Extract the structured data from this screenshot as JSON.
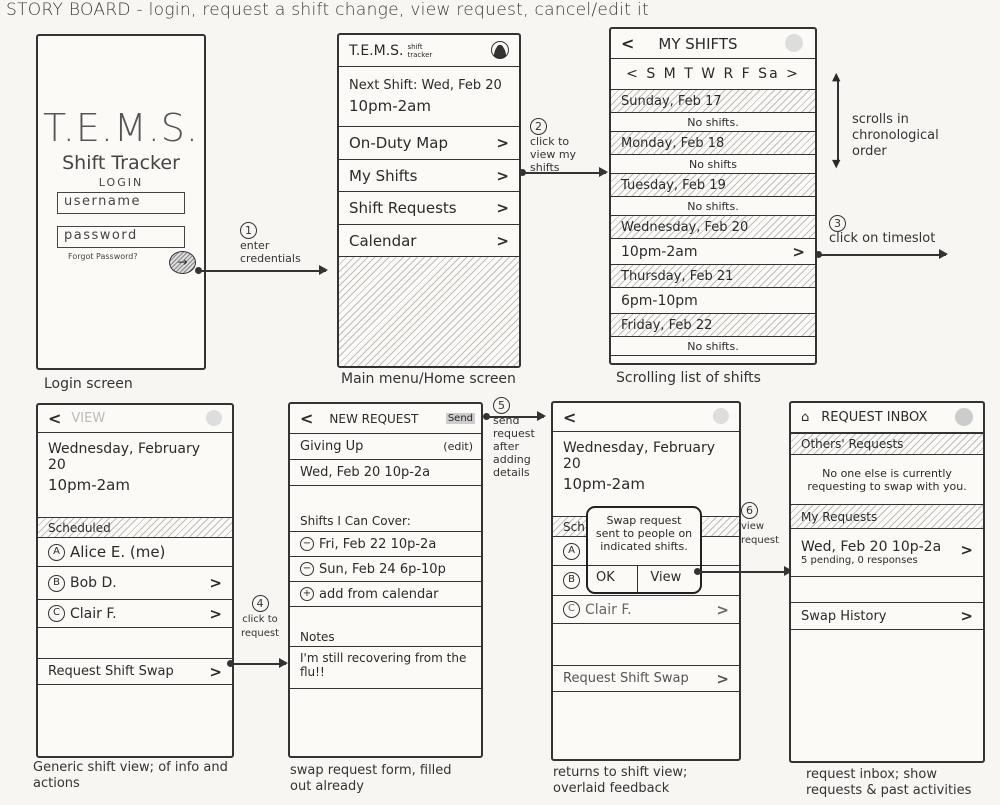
{
  "title": "STORY BOARD - login, request a shift change, view request, cancel/edit it",
  "screens": {
    "login": {
      "logo": "T.E.M.S.",
      "subtitle": "Shift Tracker",
      "heading": "LOGIN",
      "username_placeholder": "username",
      "password_placeholder": "password",
      "forgot_link": "Forgot Password?",
      "submit_icon": "arrow-right-icon",
      "caption": "Login screen"
    },
    "home": {
      "app_name": "T.E.M.S.",
      "app_sub": "shift tracker",
      "next_shift_label": "Next Shift: Wed, Feb 20",
      "next_shift_time": "10pm-2am",
      "menu": [
        {
          "label": "On-Duty Map"
        },
        {
          "label": "My Shifts"
        },
        {
          "label": "Shift Requests"
        },
        {
          "label": "Calendar"
        }
      ],
      "caption": "Main menu/Home screen"
    },
    "my_shifts": {
      "header": "MY SHIFTS",
      "week_days": "< S M T W R F Sa >",
      "days": [
        {
          "day": "Sunday, Feb 17",
          "shift": "No shifts."
        },
        {
          "day": "Monday, Feb 18",
          "shift": "No shifts"
        },
        {
          "day": "Tuesday, Feb 19",
          "shift": "No shifts."
        },
        {
          "day": "Wednesday, Feb 20",
          "shift": "10pm-2am"
        },
        {
          "day": "Thursday, Feb 21",
          "shift": "6pm-10pm"
        },
        {
          "day": "Friday, Feb 22",
          "shift": "No shifts."
        }
      ],
      "caption": "Scrolling list of shifts"
    },
    "shift_view": {
      "header": "VIEW",
      "date": "Wednesday, February 20",
      "time": "10pm-2am",
      "section": "Scheduled",
      "people": [
        {
          "name": "Alice E. (me)",
          "icon": "A"
        },
        {
          "name": "Bob D.",
          "icon": "B"
        },
        {
          "name": "Clair F.",
          "icon": "C"
        }
      ],
      "action": "Request Shift Swap",
      "caption": "Generic shift view; of info and actions"
    },
    "new_request": {
      "header": "NEW REQUEST",
      "send": "Send",
      "giving_up_label": "Giving Up",
      "edit": "(edit)",
      "giving_up_value": "Wed, Feb 20 10p-2a",
      "cover_label": "Shifts I Can Cover:",
      "cover_items": [
        {
          "label": "Fri, Feb 22 10p-2a"
        },
        {
          "label": "Sun, Feb 24 6p-10p"
        }
      ],
      "add_label": "add from calendar",
      "notes_label": "Notes",
      "notes_value": "I'm still recovering from the flu!!",
      "caption": "swap request form, filled out already"
    },
    "feedback": {
      "date": "Wednesday, February 20",
      "time": "10pm-2am",
      "section": "Sch",
      "dialog_text": "Swap request sent to people on indicated shifts.",
      "ok": "OK",
      "view": "View",
      "people": [
        {
          "name": "Clair F."
        }
      ],
      "action": "Request Shift Swap",
      "caption": "returns to shift view; overlaid feedback"
    },
    "inbox": {
      "header": "REQUEST INBOX",
      "others_label": "Others' Requests",
      "others_empty": "No one else is currently requesting to swap with you.",
      "mine_label": "My Requests",
      "request_title": "Wed, Feb 20 10p-2a",
      "request_status": "5 pending, 0 responses",
      "history": "Swap History",
      "caption": "request inbox; show requests & past activities"
    }
  },
  "annotations": [
    {
      "step": "1",
      "text": "enter credentials"
    },
    {
      "step": "2",
      "text": "click to view my shifts"
    },
    {
      "step": "3",
      "text": "click on timeslot"
    },
    {
      "step": "4",
      "text": "click to request"
    },
    {
      "step": "5",
      "text": "send request after adding details"
    },
    {
      "step": "6",
      "text": "view request"
    }
  ],
  "scroll_note": "scrolls in chronological order"
}
